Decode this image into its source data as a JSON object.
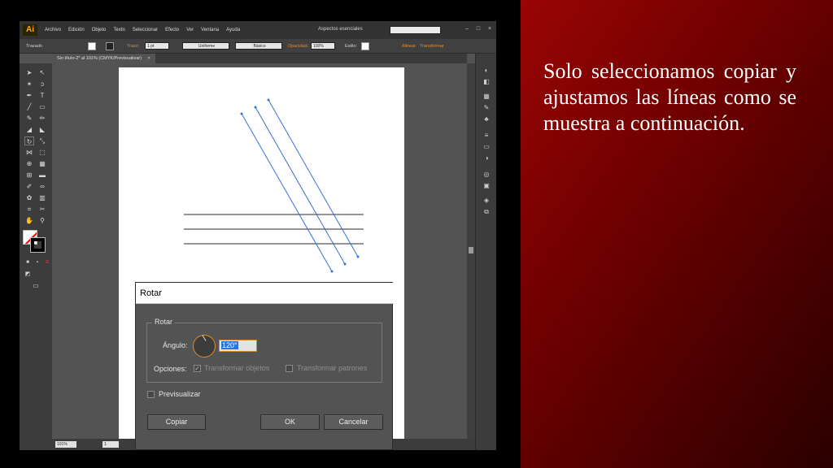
{
  "menubar": {
    "logo": "Ai",
    "items": [
      "Archivo",
      "Edición",
      "Objeto",
      "Texto",
      "Seleccionar",
      "Efecto",
      "Ver",
      "Ventana",
      "Ayuda"
    ],
    "workspace": "Aspectos esenciales"
  },
  "controlbar": {
    "object_type": "Trazado",
    "stroke_label": "Trazo:",
    "stroke_weight": "1 pt",
    "profile": "Uniforme",
    "brush": "Básico",
    "opacity_label": "Opacidad:",
    "opacity_value": "100%",
    "style_label": "Estilo:",
    "align_label": "Alinear",
    "transform_label": "Transformar"
  },
  "document_tab": {
    "title": "Sin título-2* al 101% (CMYK/Previsualizar)",
    "close": "×"
  },
  "statusbar": {
    "zoom": "101%",
    "page": "1"
  },
  "dialog": {
    "title": "Rotar",
    "group_label": "Rotar",
    "angle_label": "Ángulo:",
    "angle_value": "120°",
    "options_label": "Opciones:",
    "transform_objects": "Transformar objetos",
    "transform_objects_checked": true,
    "transform_patterns": "Transformar patrones",
    "transform_patterns_checked": false,
    "preview_label": "Previsualizar",
    "preview_checked": false,
    "copy_button": "Copiar",
    "ok_button": "OK",
    "cancel_button": "Cancelar"
  },
  "caption": {
    "text": "Solo seleccionamos copiar y ajustamos las líneas como se muestra a continuación."
  },
  "colors": {
    "slide_red": "#8b0000",
    "selection_blue": "#3a6fd8",
    "accent_orange": "#e88a2c"
  }
}
